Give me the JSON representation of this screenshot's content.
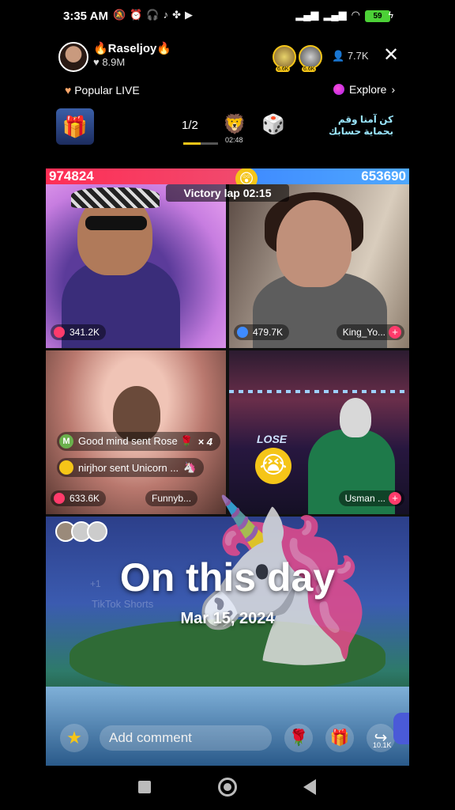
{
  "status_bar": {
    "time": "3:35 AM",
    "icons": [
      "mute-icon",
      "alarm-icon",
      "headphones-icon",
      "tiktok-icon",
      "app-icon",
      "youtube-icon"
    ],
    "battery": "59"
  },
  "header": {
    "host_name": "🔥Raseljoy🔥",
    "host_likes": "♥ 8.9M",
    "viewer_badges": [
      "6.6K",
      "6.6K"
    ],
    "viewer_count": "7.7K"
  },
  "subheader": {
    "popular_label": "Popular LIVE",
    "explore_label": "Explore"
  },
  "promo": {
    "page_counter": "1/2",
    "gift_timer": "02:48",
    "arabic_text": "كن آمنا وقم بحماية حسابك"
  },
  "battle": {
    "score_left": "974824",
    "score_right": "653690",
    "victory_lap": "Victory lap 02:15",
    "tiles": [
      {
        "stat": "341.2K",
        "user": ""
      },
      {
        "stat": "479.7K",
        "user": "King_Yo..."
      },
      {
        "stat": "633.6K",
        "user": "Funnyb..."
      },
      {
        "stat": "",
        "user": "Usman ..."
      }
    ],
    "lose_label": "LOSE",
    "comments": [
      {
        "avatar": "M",
        "text": "Good mind sent Rose 🌹",
        "extra": "× 4"
      },
      {
        "avatar": "",
        "text": "nirjhor sent Unicorn ...",
        "extra": ""
      }
    ]
  },
  "overlay": {
    "title": "On this day",
    "date": "Mar 15, 2024",
    "faint_1": "+1",
    "faint_2": "TikTok Shorts"
  },
  "bottom": {
    "comment_placeholder": "Add comment",
    "share_count": "10.1K"
  },
  "colors": {
    "score_red": "#ff2e55",
    "score_blue": "#3f8bff",
    "accent_yellow": "#f5c518"
  }
}
